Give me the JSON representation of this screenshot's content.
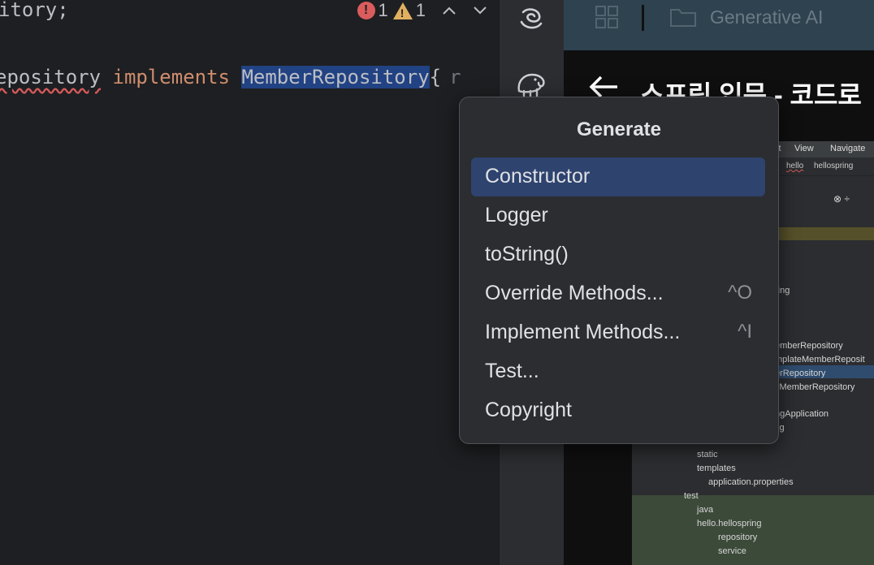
{
  "editor": {
    "top_line": "itory;",
    "inspections": {
      "errors": "1",
      "warnings": "1"
    },
    "code": {
      "class_part": "epository",
      "keyword": "implements",
      "selected": "MemberRepository",
      "brace": "{",
      "hint": "r"
    }
  },
  "browser": {
    "tab_title": "Generative AI",
    "page_title": "스프링 입문 - 코드로",
    "screenshot": {
      "menu": [
        "it",
        "View",
        "Navigate"
      ],
      "breadcrumb": [
        "hello",
        "hellospring"
      ],
      "tree": [
        "ring",
        "emberRepository",
        "mplateMemberReposit",
        "erRepository",
        "yMemberRepository",
        "ngApplication",
        "fig",
        "resources",
        "static",
        "templates",
        "application.properties",
        "test",
        "java",
        "hello.hellospring",
        "repository",
        "service"
      ]
    }
  },
  "popup": {
    "title": "Generate",
    "items": [
      {
        "label": "Constructor",
        "shortcut": ""
      },
      {
        "label": "Logger",
        "shortcut": ""
      },
      {
        "label": "toString()",
        "shortcut": ""
      },
      {
        "label": "Override Methods...",
        "shortcut": "^O"
      },
      {
        "label": "Implement Methods...",
        "shortcut": "^I"
      },
      {
        "label": "Test...",
        "shortcut": ""
      },
      {
        "label": "Copyright",
        "shortcut": ""
      }
    ],
    "selected_index": 0
  },
  "icons": {
    "error": "error-circle-icon",
    "warning": "warning-triangle-icon",
    "up": "chevron-up-icon",
    "down": "chevron-down-icon",
    "ai_assistant": "ai-assistant-icon",
    "gradle": "gradle-elephant-icon",
    "grid": "grid-icon",
    "folder": "folder-icon",
    "back": "back-arrow-icon"
  },
  "colors": {
    "editor_bg": "#1e1f22",
    "popup_bg": "#2b2d30",
    "selection": "#2e436e",
    "keyword": "#cf8e6d",
    "error": "#db5c5c",
    "warning": "#e0b060"
  }
}
